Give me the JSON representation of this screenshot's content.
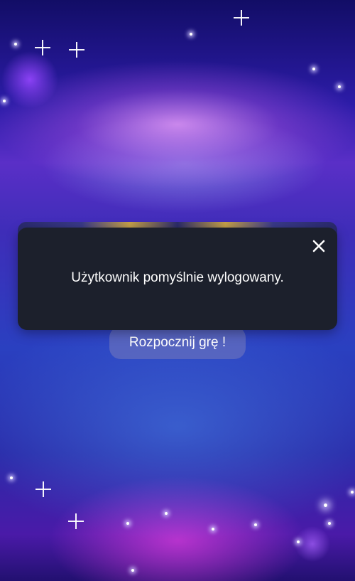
{
  "modal": {
    "message": "Użytkownik pomyślnie wylogowany.",
    "close_icon": "close-icon"
  },
  "main": {
    "start_button_label": "Rozpocznij grę !"
  },
  "colors": {
    "modal_background": "#1c202c",
    "button_background": "#6a72c0",
    "text": "#ffffff"
  }
}
